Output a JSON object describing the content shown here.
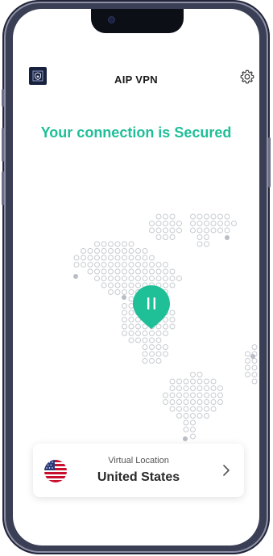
{
  "header": {
    "title": "AIP VPN"
  },
  "status": {
    "text": "Your connection is Secured"
  },
  "location": {
    "label": "Virtual Location",
    "value": "United States"
  },
  "icons": {
    "logo": "shield-logo-icon",
    "settings": "gear-icon",
    "pin": "location-pin-pause-icon",
    "flag": "us-flag-icon",
    "chevron": "chevron-right-icon"
  },
  "colors": {
    "accent": "#1fbf98",
    "dots": "#c7cbd1"
  }
}
